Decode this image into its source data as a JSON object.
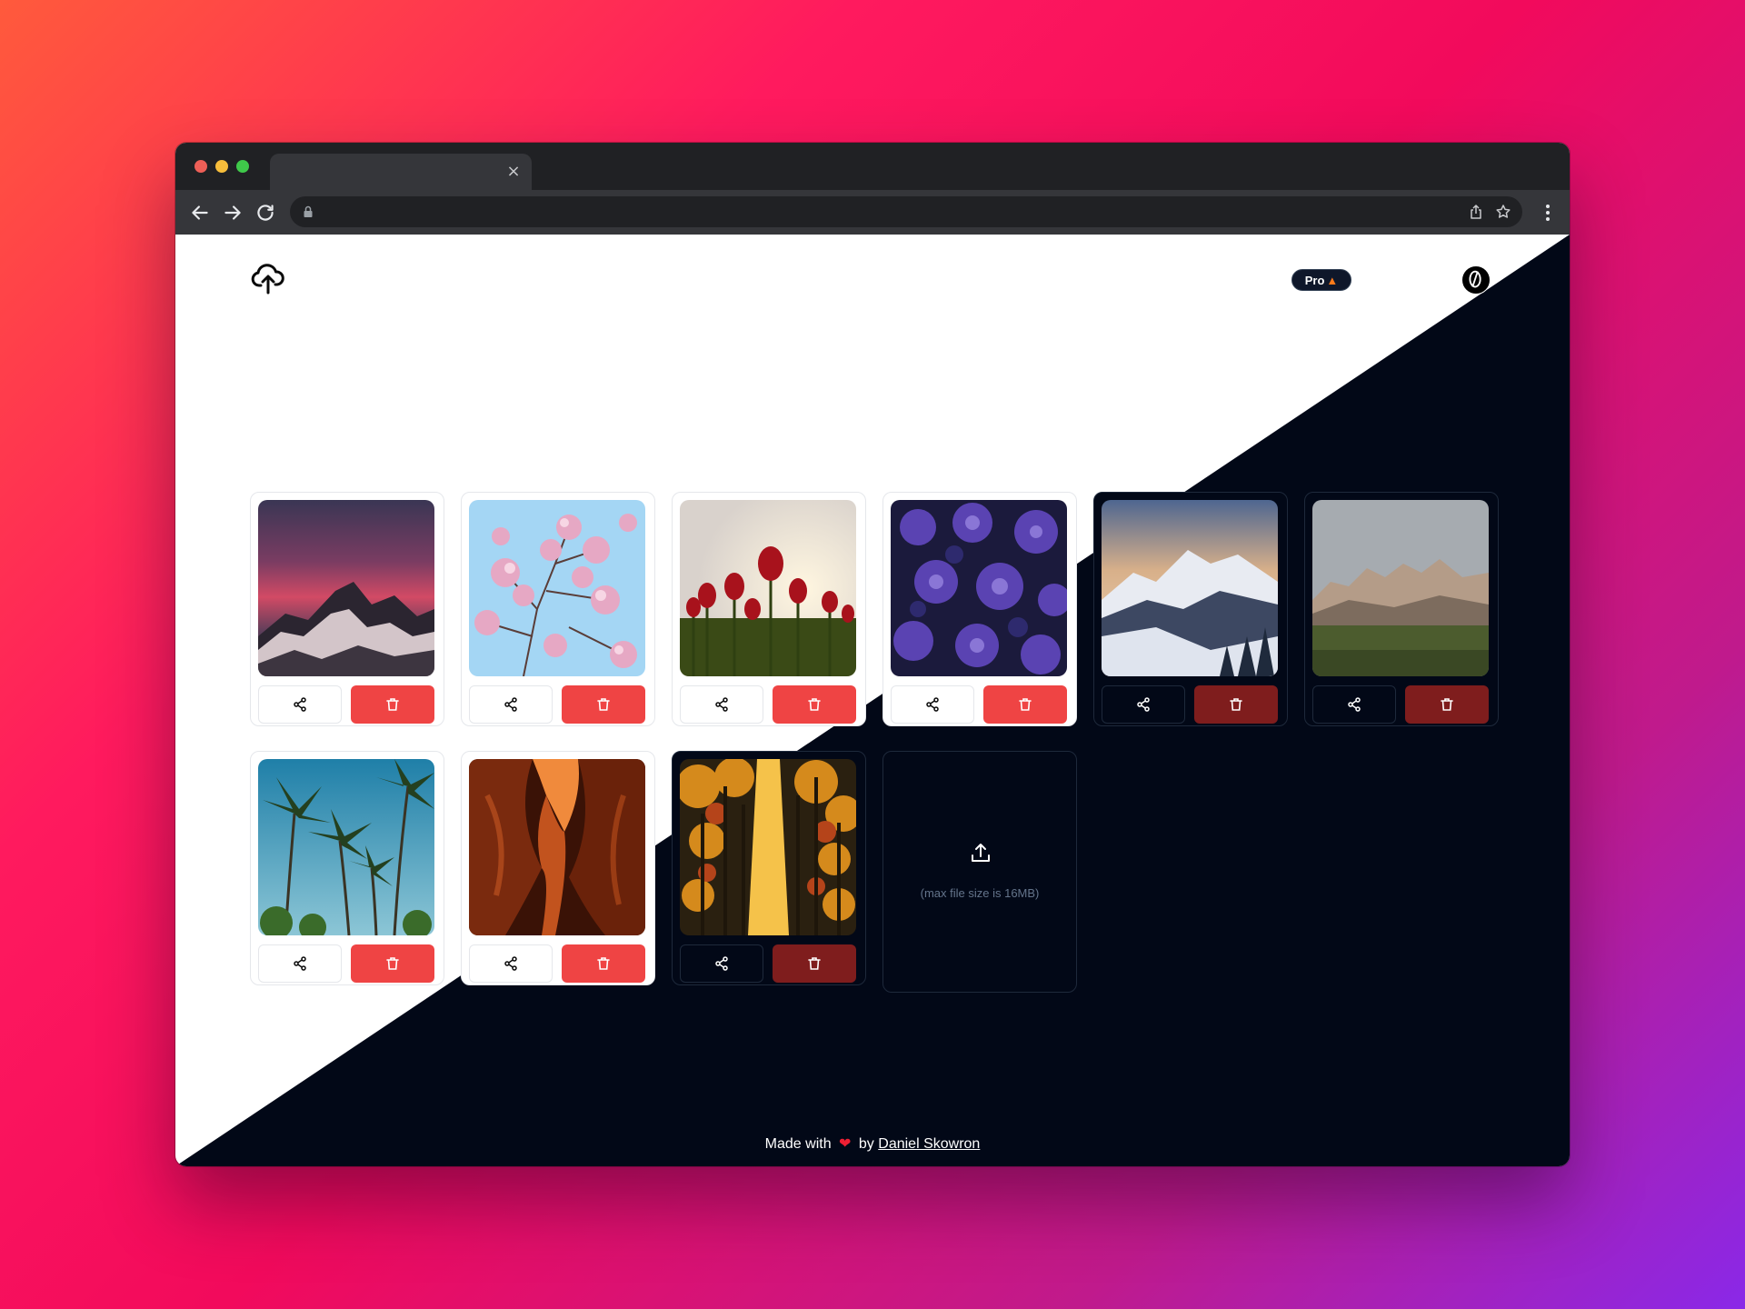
{
  "browser": {
    "tab_close": "×"
  },
  "header": {
    "pro_badge": "Pro",
    "pro_badge_icon": "flame-icon"
  },
  "gallery": {
    "images": [
      {
        "subject": "mountain-sunset",
        "colors": [
          "#3e3553",
          "#c84c62",
          "#d5c5c8",
          "#2a2733"
        ]
      },
      {
        "subject": "cherry-blossom",
        "colors": [
          "#9fd3f2",
          "#e7a9c2",
          "#6b4a45",
          "#cde8f7"
        ]
      },
      {
        "subject": "red-tulips",
        "colors": [
          "#e8e2da",
          "#a8141c",
          "#3d4d18",
          "#f4dcb0"
        ]
      },
      {
        "subject": "purple-hydrangea",
        "colors": [
          "#1e1d42",
          "#6a4bc4",
          "#3a2f86",
          "#8f7ad8"
        ]
      },
      {
        "subject": "snowy-mountains",
        "colors": [
          "#5b6f8e",
          "#e8ebf2",
          "#29344a",
          "#d9a878"
        ]
      },
      {
        "subject": "rocky-ridge-meadow",
        "colors": [
          "#a0a6ab",
          "#b9a391",
          "#4b5b2e",
          "#6d6d5f"
        ]
      },
      {
        "subject": "palm-trees",
        "colors": [
          "#2e8fb0",
          "#233b1f",
          "#7fb8c8",
          "#3a5d2a"
        ]
      },
      {
        "subject": "red-canyon",
        "colors": [
          "#4a1607",
          "#c2531e",
          "#f08a3c",
          "#2a0b04"
        ]
      },
      {
        "subject": "autumn-forest",
        "colors": [
          "#2a2010",
          "#d58a1c",
          "#f5c24a",
          "#5b3a14"
        ]
      }
    ],
    "share_icon": "share-icon",
    "delete_icon": "trash-icon"
  },
  "upload": {
    "icon": "upload-icon",
    "hint": "(max file size is 16MB)"
  },
  "footer": {
    "made_with": "Made with",
    "heart": "❤",
    "by": "by",
    "author": "Daniel Skowron"
  },
  "theme": {
    "light_bg": "#ffffff",
    "dark_bg": "#020817",
    "delete_red": "#ef4444",
    "delete_red_dark": "#7f1d1d"
  }
}
